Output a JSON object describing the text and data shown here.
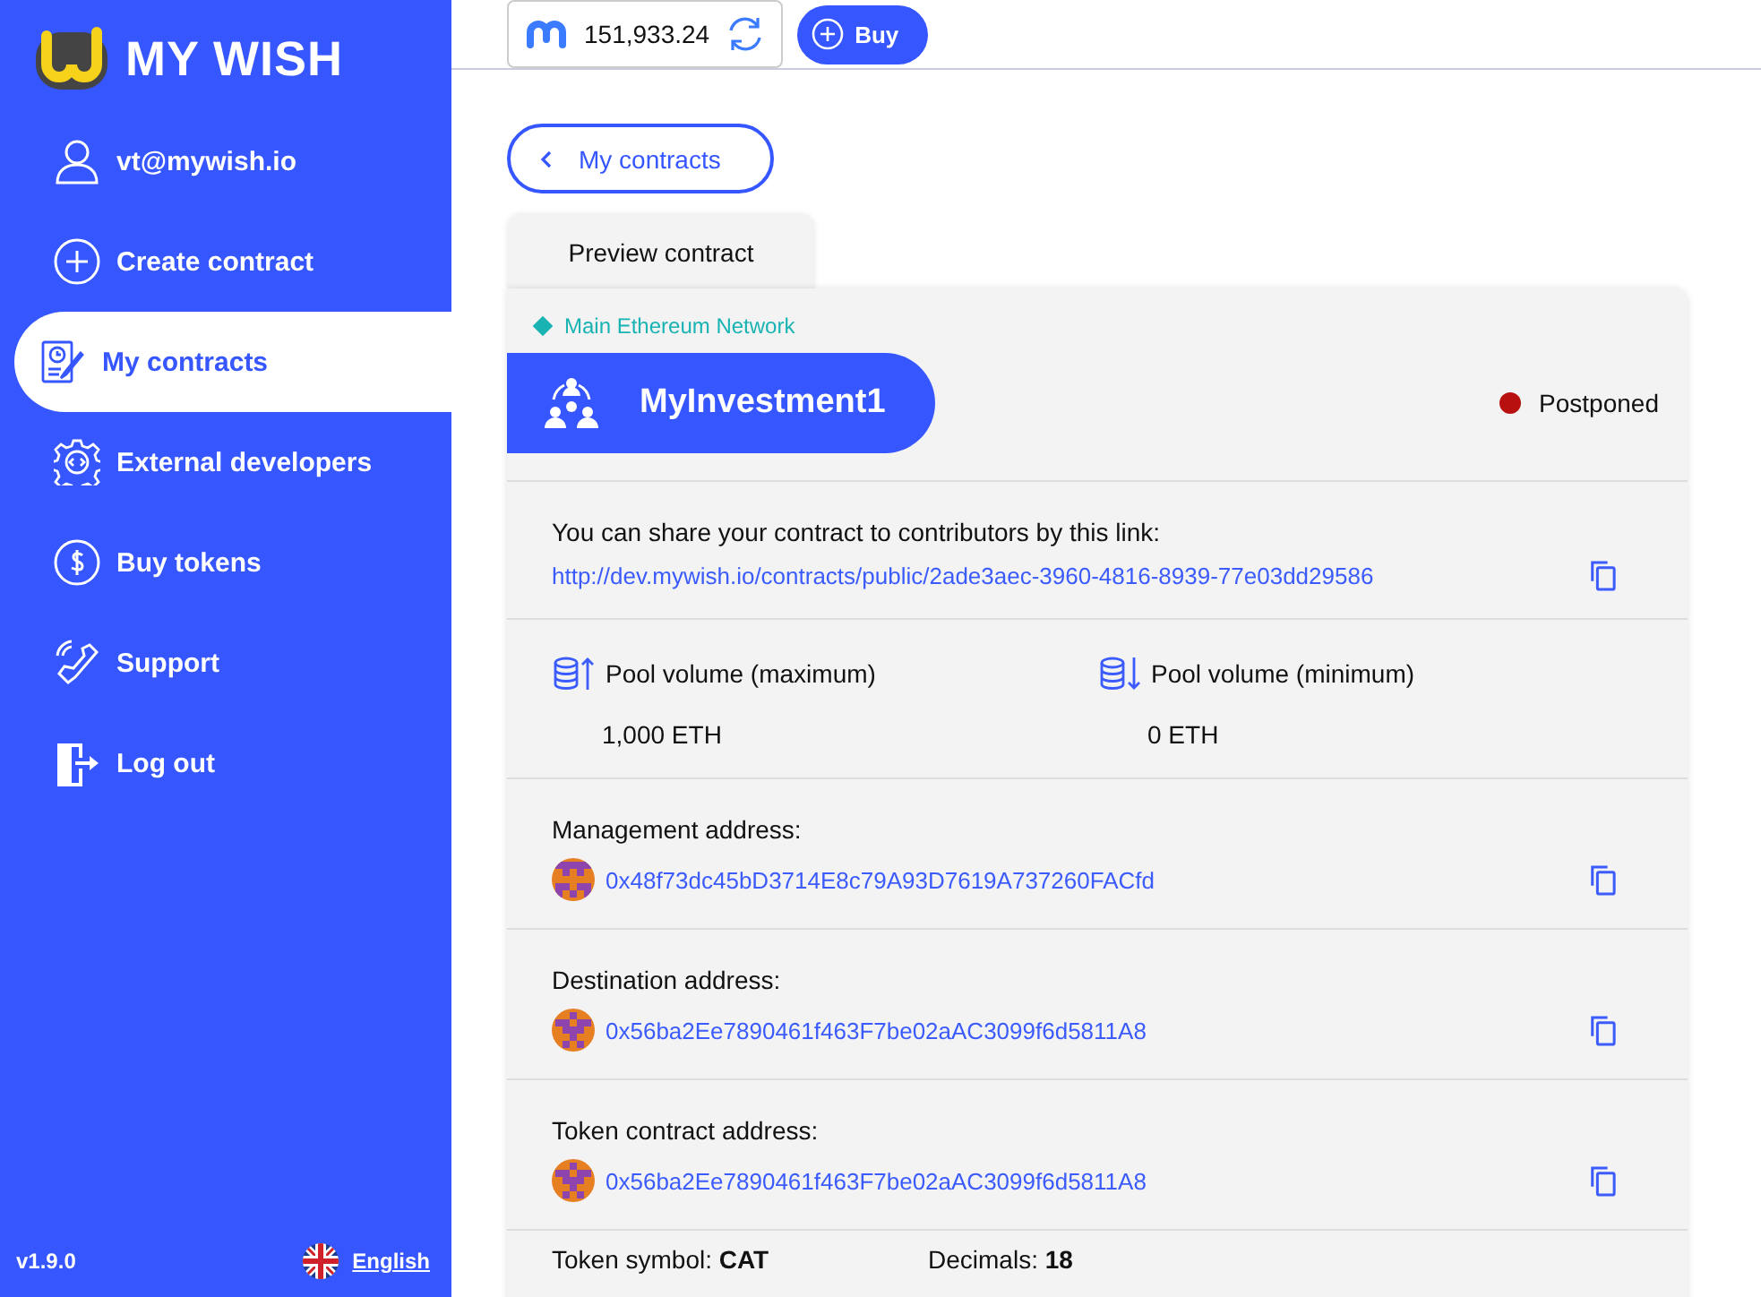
{
  "sidebar": {
    "logo": "MY WISH",
    "items": [
      {
        "kind": "user",
        "label": "vt@mywish.io",
        "selected": false
      },
      {
        "kind": "plus",
        "label": "Create contract",
        "selected": false
      },
      {
        "kind": "contract",
        "label": "My contracts",
        "selected": true
      },
      {
        "kind": "gear",
        "label": "External developers",
        "selected": false
      },
      {
        "kind": "dollar",
        "label": "Buy tokens",
        "selected": false
      },
      {
        "kind": "phone",
        "label": "Support",
        "selected": false
      },
      {
        "kind": "logout",
        "label": "Log out",
        "selected": false
      }
    ],
    "version": "v1.9.0",
    "language": "English"
  },
  "topbar": {
    "balance": "151,933.24",
    "buy_button": "Buy"
  },
  "back_button": "My contracts",
  "tab": "Preview contract",
  "contract": {
    "network": "Main Ethereum Network",
    "name": "MyInvestment1",
    "status": {
      "label": "Postponed",
      "color": "#b80f0f"
    },
    "share": {
      "label": "You can share your contract to contributors by this link:",
      "link": "http://dev.mywish.io/contracts/public/2ade3aec-3960-4816-8939-77e03dd29586"
    },
    "pools": [
      {
        "kind": "max",
        "label": "Pool volume (maximum)",
        "value": "1,000 ETH"
      },
      {
        "kind": "min",
        "label": "Pool volume (minimum)",
        "value": "0 ETH"
      }
    ],
    "addresses": [
      {
        "label": "Management address:",
        "address": "0x48f73dc45bD3714E8c79A93D7619A737260FACfd"
      },
      {
        "label": "Destination address:",
        "address": "0x56ba2Ee7890461f463F7be02aAC3099f6d5811A8"
      },
      {
        "label": "Token contract address:",
        "address": "0x56ba2Ee7890461f463F7be02aAC3099f6d5811A8"
      }
    ],
    "token_fields": [
      {
        "label": "Token symbol:",
        "value": "CAT"
      },
      {
        "label": "Decimals:",
        "value": "18"
      }
    ]
  }
}
